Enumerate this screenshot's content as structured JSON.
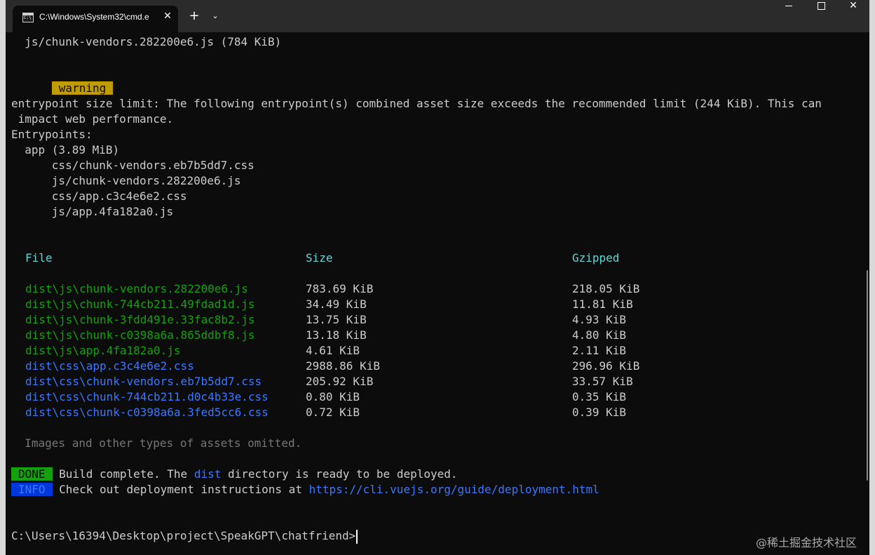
{
  "window": {
    "tab_title": "C:\\Windows\\System32\\cmd.e",
    "tab_close": "✕",
    "new_tab": "+",
    "dropdown": "⌄",
    "close": "✕"
  },
  "terminal": {
    "line_asset": "  js/chunk-vendors.282200e6.js (784 KiB)",
    "warning_badge": "warning",
    "entry_line1": "entrypoint size limit: The following entrypoint(s) combined asset size exceeds the recommended limit (244 KiB). This can",
    "entry_line2": " impact web performance.",
    "entrypoints_label": "Entrypoints:",
    "app_entry": "  app (3.89 MiB)",
    "entry_files": [
      "      css/chunk-vendors.eb7b5dd7.css",
      "      js/chunk-vendors.282200e6.js",
      "      css/app.c3c4e6e2.css",
      "      js/app.4fa182a0.js"
    ],
    "table": {
      "headers": {
        "file": "File",
        "size": "Size",
        "gzipped": "Gzipped"
      },
      "rows": [
        {
          "file": "dist\\js\\chunk-vendors.282200e6.js",
          "size": "783.69 KiB",
          "gzipped": "218.05 KiB",
          "kind": "js"
        },
        {
          "file": "dist\\js\\chunk-744cb211.49fdad1d.js",
          "size": "34.49 KiB",
          "gzipped": "11.81 KiB",
          "kind": "js"
        },
        {
          "file": "dist\\js\\chunk-3fdd491e.33fac8b2.js",
          "size": "13.75 KiB",
          "gzipped": "4.93 KiB",
          "kind": "js"
        },
        {
          "file": "dist\\js\\chunk-c0398a6a.865ddbf8.js",
          "size": "13.18 KiB",
          "gzipped": "4.80 KiB",
          "kind": "js"
        },
        {
          "file": "dist\\js\\app.4fa182a0.js",
          "size": "4.61 KiB",
          "gzipped": "2.11 KiB",
          "kind": "js"
        },
        {
          "file": "dist\\css\\app.c3c4e6e2.css",
          "size": "2988.86 KiB",
          "gzipped": "296.96 KiB",
          "kind": "css"
        },
        {
          "file": "dist\\css\\chunk-vendors.eb7b5dd7.css",
          "size": "205.92 KiB",
          "gzipped": "33.57 KiB",
          "kind": "css"
        },
        {
          "file": "dist\\css\\chunk-744cb211.d0c4b33e.css",
          "size": "0.80 KiB",
          "gzipped": "0.35 KiB",
          "kind": "css"
        },
        {
          "file": "dist\\css\\chunk-c0398a6a.3fed5cc6.css",
          "size": "0.72 KiB",
          "gzipped": "0.39 KiB",
          "kind": "css"
        }
      ]
    },
    "omitted_note": "  Images and other types of assets omitted.",
    "done_badge": "DONE",
    "done_text_pre": " Build complete. The ",
    "done_dist": "dist",
    "done_text_post": " directory is ready to be deployed.",
    "info_badge": "INFO",
    "info_text": " Check out deployment instructions at ",
    "info_link": "https://cli.vuejs.org/guide/deployment.html",
    "prompt": "C:\\Users\\16394\\Desktop\\project\\SpeakGPT\\chatfriend>"
  },
  "watermark": "@稀土掘金技术社区",
  "colors": {
    "background": "#0c0c0c",
    "text": "#cccccc",
    "green": "#13a10e",
    "blue": "#3b78ff",
    "cyan": "#61d6d6",
    "warning_bg": "#c19c00",
    "info_bg": "#0037da"
  }
}
